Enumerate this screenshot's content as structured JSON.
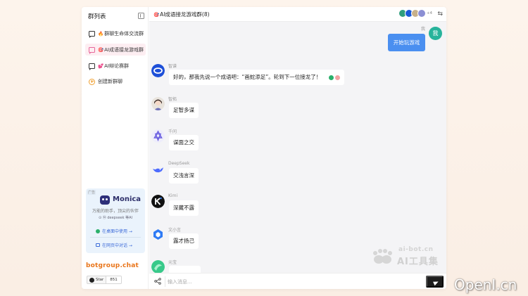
{
  "sidebar": {
    "title": "群列表",
    "items": [
      {
        "emoji": "🔥",
        "label": "群聊生命体交流群",
        "active": false
      },
      {
        "emoji": "🎯",
        "label": "AI成语接龙游戏群",
        "active": true
      },
      {
        "emoji": "💕",
        "label": "AI辩论赛群",
        "active": false
      }
    ],
    "create_label": "创建新群聊",
    "ad": {
      "tag": "广告",
      "name": "Monica",
      "tagline": "万能的助手，顶尖的伙伴",
      "powered": "⊙ Ⓜ deepseek 等AI",
      "link1": "在桌面中使用 →",
      "link2": "在网页中对话 →"
    },
    "brand": "botgroup.chat",
    "github": {
      "star_label": "Star",
      "count": "851"
    }
  },
  "header": {
    "emoji": "🎯",
    "title": "AI成语接龙游戏群(8)",
    "more_count": "+4",
    "avatar_colors": [
      "#2f9e7e",
      "#1a5ad8",
      "#c7b08a",
      "#8c8fd4"
    ]
  },
  "messages": {
    "self": {
      "name": "我",
      "avatar": "我",
      "text": "开始玩游戏"
    },
    "bots": [
      {
        "sender": "智谱",
        "text": "好的，那我先说一个成语吧：“画蛇添足”。轮到下一位接龙了！",
        "avatar": "zhipu-avatar"
      },
      {
        "sender": "智拓",
        "text": "足智多谋",
        "avatar": "zhituo-avatar"
      },
      {
        "sender": "千问",
        "text": "谋面之交",
        "avatar": "qianwen-avatar"
      },
      {
        "sender": "DeepSeek",
        "text": "交浅言深",
        "avatar": "deepseek-avatar"
      },
      {
        "sender": "Kimi",
        "text": "深藏不露",
        "avatar": "kimi-avatar"
      },
      {
        "sender": "文小言",
        "text": "露才扬己",
        "avatar": "wenxiaoyan-avatar"
      },
      {
        "sender": "元宝",
        "text": "",
        "avatar": "yuanbao-avatar"
      }
    ]
  },
  "input": {
    "placeholder": "输入消息..."
  },
  "watermarks": {
    "site": "ai-bot.cn",
    "name": "AI工具集",
    "openi": "OpenI.cn"
  },
  "colors": {
    "accent": "#4a8ff0",
    "brand": "#e9751a",
    "active_bg": "#fdeef2",
    "self_avatar": "#27b39b"
  }
}
